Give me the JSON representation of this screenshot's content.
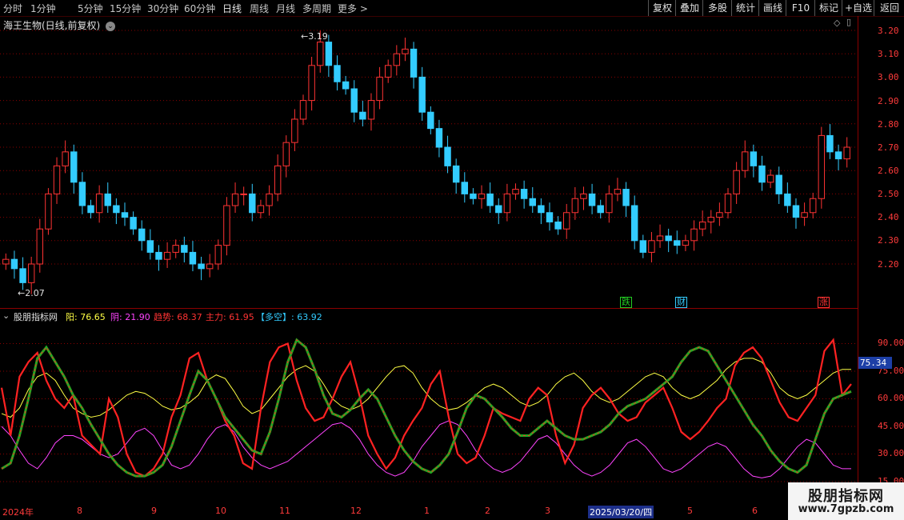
{
  "toolbar": {
    "periods": [
      "分时",
      "1分钟",
      "5分钟",
      "15分钟",
      "30分钟",
      "60分钟",
      "日线",
      "周线",
      "月线",
      "多周期",
      "更多 >"
    ],
    "active": "日线",
    "right_buttons": [
      "复权",
      "叠加",
      "多股",
      "统计",
      "画线",
      "F10",
      "标记",
      "+自选",
      "返回"
    ]
  },
  "price_panel": {
    "title": "海王生物(日线,前复权)",
    "high_label": "3.19",
    "low_label": "2.07",
    "markers": [
      {
        "text": "跌",
        "color": "#22cc22"
      },
      {
        "text": "财",
        "color": "#33ccff"
      },
      {
        "text": "涨",
        "color": "#ff3333"
      }
    ],
    "y_ticks": [
      "3.20",
      "3.10",
      "3.00",
      "2.90",
      "2.80",
      "2.70",
      "2.60",
      "2.50",
      "2.40",
      "2.30",
      "2.20"
    ]
  },
  "indicator": {
    "name": "股朋指标网",
    "items": [
      {
        "label": "阳: ",
        "value": "76.65",
        "color": "#ffff44"
      },
      {
        "label": "阴: ",
        "value": "21.90",
        "color": "#ff44ff"
      },
      {
        "label": "趋势: ",
        "value": "68.37",
        "color": "#ff3333"
      },
      {
        "label": "主力: ",
        "value": "61.95",
        "color": "#ff3333"
      },
      {
        "label": "【多空】: ",
        "value": "63.92",
        "color": "#33ccff"
      }
    ],
    "y_ticks": [
      "90.00",
      "75.00",
      "60.00",
      "45.00",
      "30.00",
      "15.00"
    ],
    "current_value": "75.34"
  },
  "x_axis": {
    "labels": [
      "2024年",
      "8",
      "9",
      "10",
      "11",
      "12",
      "1",
      "2",
      "3",
      "2025/03/20/四",
      "5",
      "6"
    ]
  },
  "watermark": {
    "line1": "股朋指标网",
    "line2": "www.7gpzb.com"
  },
  "colors": {
    "up": "#ff3333",
    "down": "#33ccff",
    "grid": "#8a0000",
    "yang": "#ffff44",
    "yin": "#ff44ff",
    "trend": "#ff2222",
    "main": "#22aa22"
  },
  "chart_data": [
    {
      "type": "candlestick",
      "title": "海王生物(日线,前复权)",
      "ylim": [
        2.07,
        3.2
      ],
      "y_ticks": [
        3.2,
        3.1,
        3.0,
        2.9,
        2.8,
        2.7,
        2.6,
        2.5,
        2.4,
        2.3,
        2.2
      ],
      "x_months": [
        "2024-07",
        "2024-08",
        "2024-09",
        "2024-10",
        "2024-11",
        "2024-12",
        "2025-01",
        "2025-02",
        "2025-03",
        "2025-04",
        "2025-05",
        "2025-06"
      ],
      "close": [
        2.22,
        2.18,
        2.12,
        2.2,
        2.35,
        2.5,
        2.62,
        2.68,
        2.55,
        2.45,
        2.42,
        2.5,
        2.45,
        2.42,
        2.4,
        2.35,
        2.3,
        2.25,
        2.22,
        2.25,
        2.28,
        2.25,
        2.2,
        2.18,
        2.2,
        2.28,
        2.45,
        2.5,
        2.5,
        2.42,
        2.45,
        2.5,
        2.62,
        2.72,
        2.82,
        2.9,
        3.05,
        3.15,
        3.05,
        2.98,
        2.95,
        2.85,
        2.82,
        2.9,
        3.0,
        3.05,
        3.1,
        3.12,
        3.0,
        2.85,
        2.78,
        2.7,
        2.62,
        2.55,
        2.5,
        2.48,
        2.5,
        2.45,
        2.42,
        2.5,
        2.52,
        2.48,
        2.45,
        2.42,
        2.38,
        2.35,
        2.42,
        2.48,
        2.5,
        2.45,
        2.42,
        2.5,
        2.52,
        2.45,
        2.3,
        2.25,
        2.3,
        2.32,
        2.3,
        2.28,
        2.3,
        2.35,
        2.38,
        2.4,
        2.42,
        2.5,
        2.6,
        2.68,
        2.62,
        2.55,
        2.58,
        2.5,
        2.45,
        2.4,
        2.42,
        2.48,
        2.75,
        2.68,
        2.65,
        2.7
      ]
    },
    {
      "type": "line",
      "title": "股朋指标网",
      "ylim": [
        15,
        100
      ],
      "y_ticks": [
        90,
        75,
        60,
        45,
        30,
        15
      ],
      "series": [
        {
          "name": "阳",
          "values": [
            52,
            50,
            55,
            65,
            72,
            74,
            70,
            62,
            55,
            52,
            50,
            51,
            54,
            58,
            62,
            64,
            63,
            60,
            56,
            54,
            55,
            58,
            62,
            70,
            73,
            71,
            64,
            56,
            52,
            54,
            60,
            66,
            72,
            76,
            78,
            75,
            68,
            60,
            56,
            54,
            56,
            60,
            66,
            72,
            77,
            78,
            74,
            66,
            60,
            56,
            54,
            55,
            58,
            62,
            66,
            68,
            66,
            62,
            58,
            56,
            58,
            62,
            68,
            72,
            74,
            70,
            64,
            60,
            58,
            60,
            64,
            68,
            72,
            74,
            72,
            66,
            62,
            60,
            62,
            66,
            70,
            76,
            80,
            82,
            82,
            80,
            74,
            66,
            62,
            60,
            62,
            66,
            70,
            74,
            76,
            76
          ]
        },
        {
          "name": "阴",
          "values": [
            45,
            40,
            32,
            25,
            22,
            28,
            36,
            40,
            40,
            38,
            34,
            30,
            28,
            30,
            36,
            42,
            44,
            40,
            32,
            24,
            22,
            24,
            30,
            38,
            44,
            46,
            42,
            34,
            28,
            24,
            22,
            24,
            26,
            30,
            34,
            38,
            42,
            46,
            47,
            44,
            38,
            30,
            24,
            20,
            18,
            20,
            26,
            34,
            40,
            46,
            48,
            46,
            40,
            32,
            26,
            22,
            20,
            22,
            26,
            32,
            38,
            40,
            36,
            30,
            24,
            20,
            18,
            20,
            24,
            30,
            36,
            38,
            34,
            28,
            22,
            20,
            22,
            26,
            30,
            34,
            36,
            34,
            28,
            22,
            18,
            17,
            18,
            22,
            28,
            34,
            38,
            36,
            30,
            24,
            22,
            22
          ]
        },
        {
          "name": "趋势",
          "values": [
            66,
            40,
            72,
            80,
            85,
            70,
            60,
            55,
            62,
            40,
            35,
            30,
            60,
            50,
            30,
            20,
            18,
            22,
            30,
            50,
            62,
            82,
            85,
            70,
            60,
            48,
            40,
            25,
            22,
            55,
            80,
            88,
            90,
            70,
            55,
            48,
            50,
            60,
            72,
            80,
            62,
            40,
            30,
            22,
            28,
            40,
            48,
            55,
            68,
            75,
            50,
            30,
            25,
            28,
            40,
            55,
            52,
            50,
            48,
            60,
            66,
            62,
            40,
            25,
            35,
            55,
            62,
            66,
            60,
            52,
            48,
            50,
            58,
            62,
            66,
            55,
            42,
            38,
            42,
            48,
            55,
            60,
            78,
            85,
            88,
            82,
            70,
            58,
            50,
            48,
            55,
            62,
            86,
            92,
            62,
            68
          ]
        },
        {
          "name": "主力",
          "values": [
            22,
            25,
            40,
            60,
            82,
            88,
            80,
            72,
            62,
            55,
            46,
            38,
            30,
            24,
            20,
            18,
            18,
            20,
            24,
            34,
            48,
            62,
            75,
            70,
            60,
            50,
            44,
            38,
            32,
            30,
            42,
            60,
            80,
            92,
            88,
            76,
            62,
            52,
            50,
            54,
            60,
            65,
            60,
            50,
            40,
            32,
            26,
            22,
            20,
            24,
            30,
            42,
            55,
            62,
            60,
            55,
            50,
            44,
            40,
            40,
            44,
            48,
            44,
            40,
            38,
            38,
            40,
            42,
            46,
            52,
            56,
            58,
            60,
            64,
            68,
            72,
            80,
            86,
            88,
            86,
            78,
            70,
            62,
            54,
            46,
            40,
            32,
            26,
            22,
            20,
            24,
            38,
            52,
            60,
            62,
            64
          ]
        }
      ]
    }
  ]
}
